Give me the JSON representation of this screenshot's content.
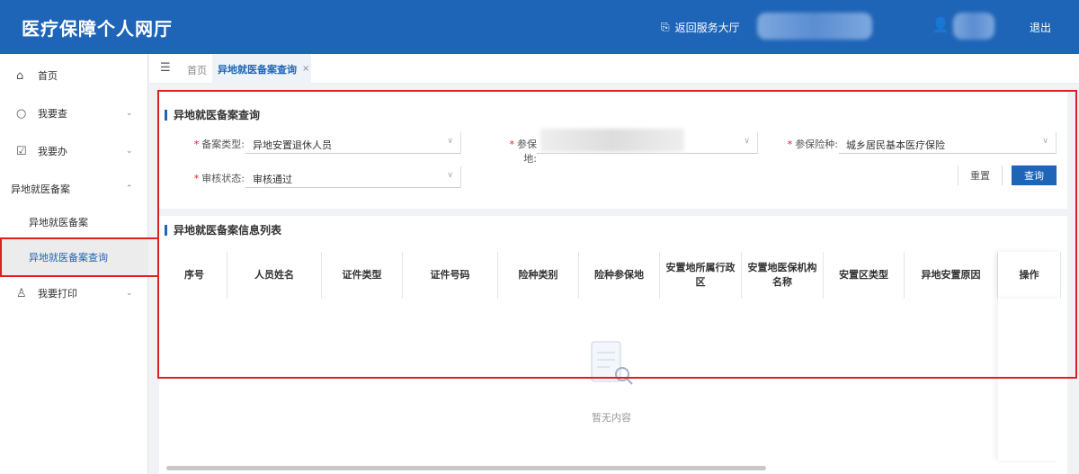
{
  "header": {
    "title": "医疗保障个人网厅",
    "back_label": "返回服务大厅",
    "logout_label": "退出"
  },
  "sidebar": {
    "items": [
      {
        "label": "首页",
        "icon": "home-icon"
      },
      {
        "label": "我要查",
        "icon": "search-icon"
      },
      {
        "label": "我要办",
        "icon": "inbox-icon"
      },
      {
        "label": "异地就医备案"
      },
      {
        "label": "异地就医备案"
      },
      {
        "label": "异地就医备案查询",
        "active": true
      },
      {
        "label": "我要打印",
        "icon": "user-icon"
      }
    ]
  },
  "tabs": {
    "home": "首页",
    "active": "异地就医备案查询",
    "close": "×"
  },
  "form": {
    "title": "异地就医备案查询",
    "fields": [
      {
        "label": "备案类型:",
        "value": "异地安置退休人员"
      },
      {
        "label": "参保地:",
        "value": ""
      },
      {
        "label": "参保险种:",
        "value": "城乡居民基本医疗保险"
      },
      {
        "label": "审核状态:",
        "value": "审核通过"
      }
    ],
    "reset": "重置",
    "query": "查询"
  },
  "list": {
    "title": "异地就医备案信息列表",
    "columns": [
      "序号",
      "人员姓名",
      "证件类型",
      "证件号码",
      "险种类别",
      "险种参保地",
      "安置地所属行政区",
      "安置地医保机构名称",
      "安置区类型",
      "异地安置原因",
      "操作"
    ],
    "empty": "暂无内容"
  },
  "colors": {
    "primary": "#1e64b7",
    "highlight": "#e02020"
  }
}
